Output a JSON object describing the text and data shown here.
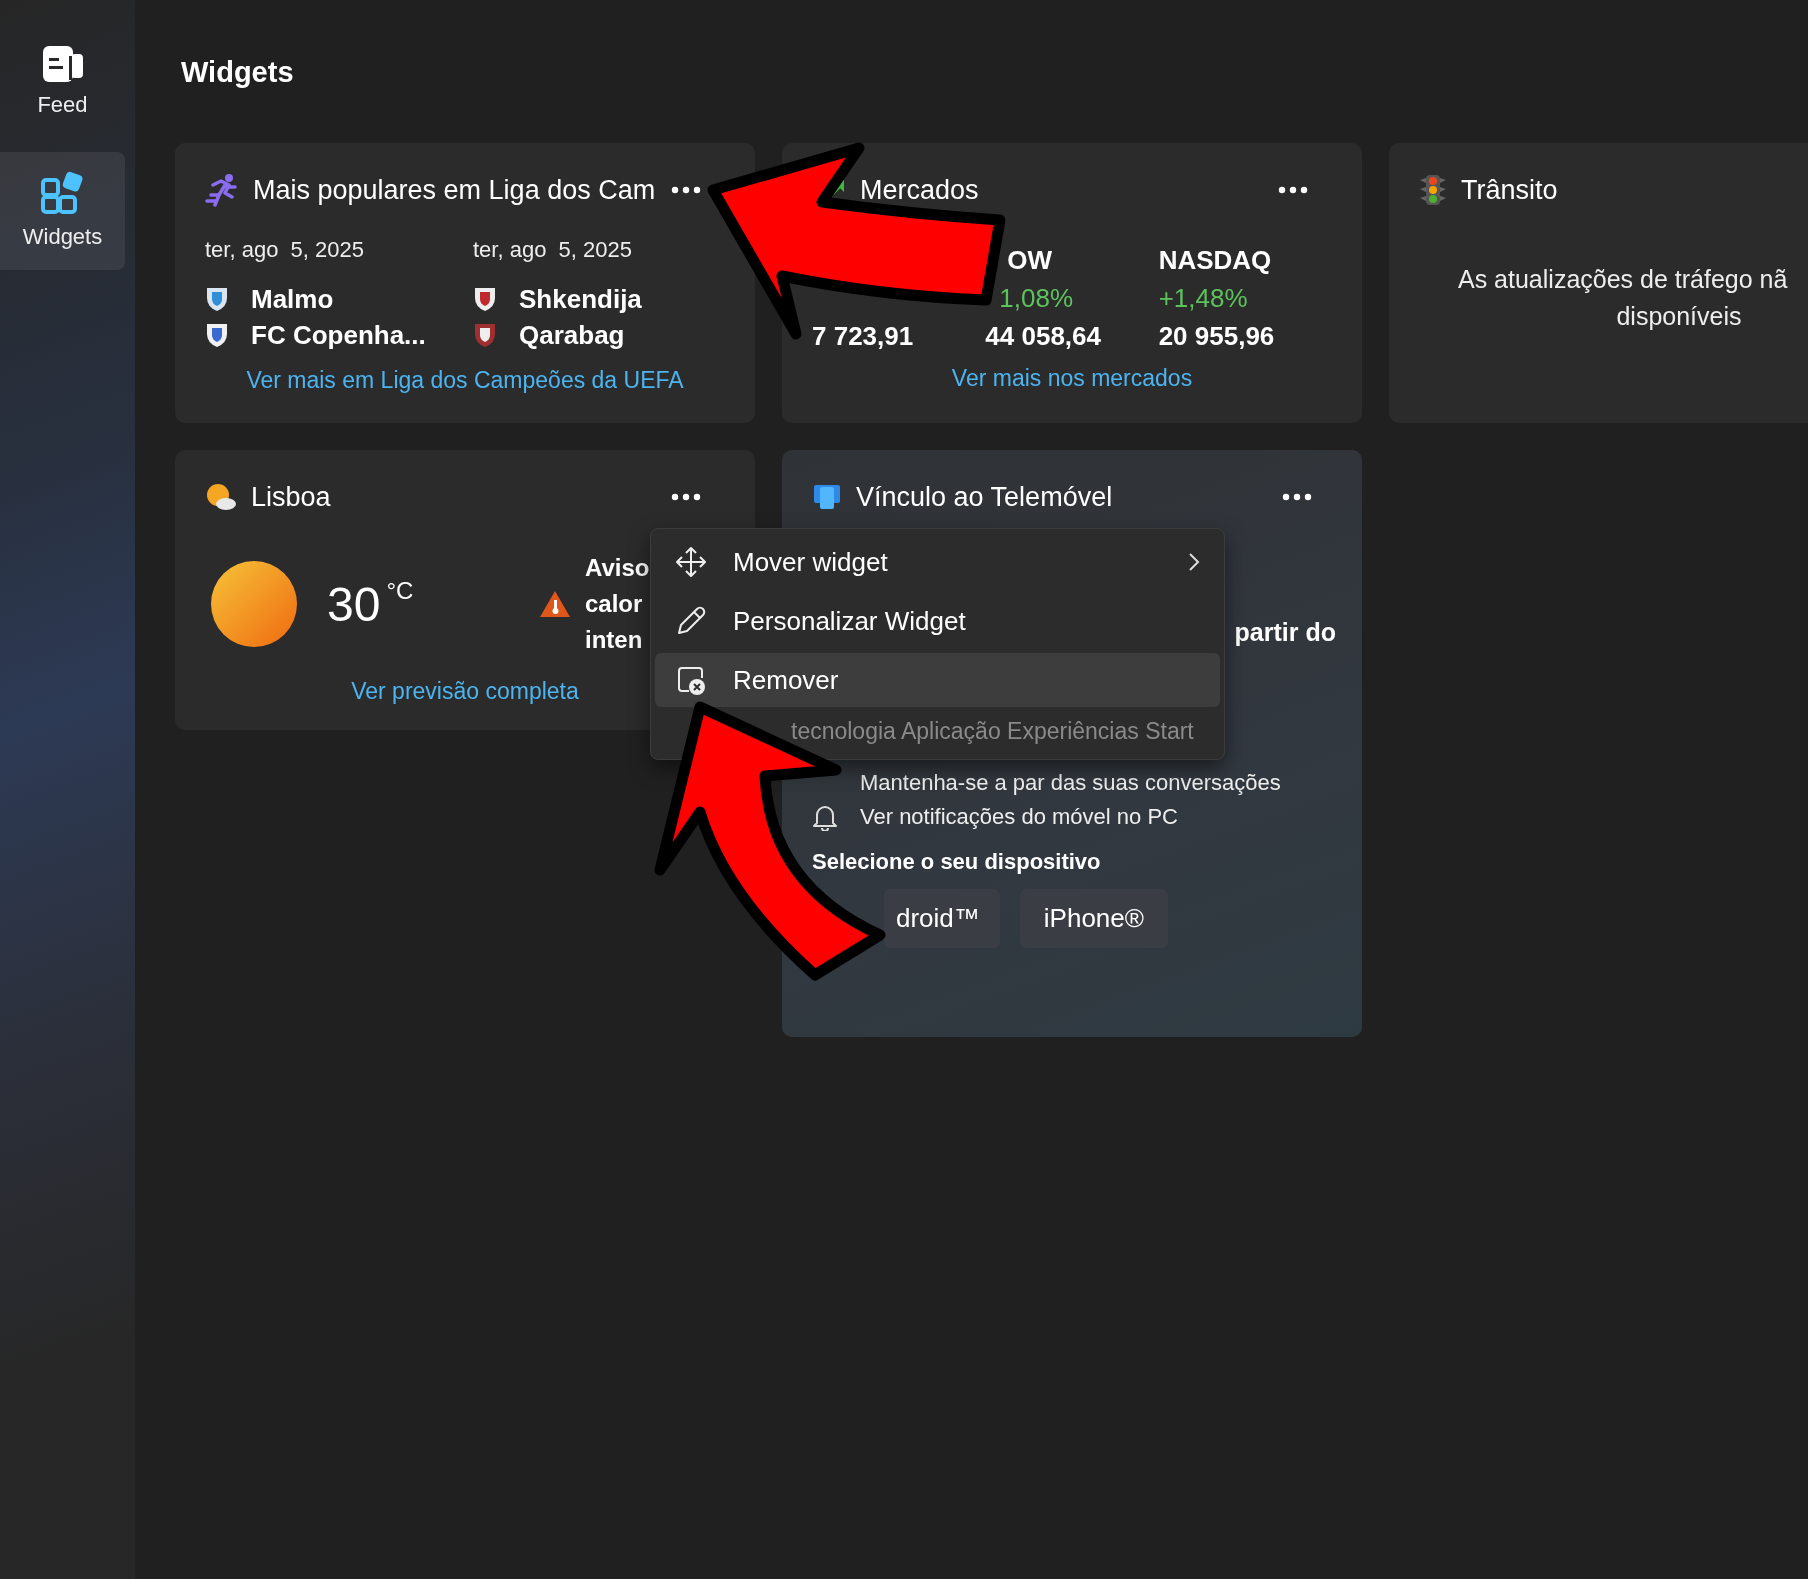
{
  "sidebar": {
    "items": [
      {
        "kind": "feed",
        "label": "Feed",
        "selected": false
      },
      {
        "kind": "widgets",
        "label": "Widgets",
        "selected": true
      }
    ]
  },
  "page_title": "Widgets",
  "widgets": [
    {
      "kind": "sports",
      "title": "Mais populares em Liga dos Cam",
      "menu_button": true,
      "matches": [
        {
          "date": "ter, ago  5, 2025",
          "teams": [
            {
              "name": "Malmo"
            },
            {
              "name": "FC Copenha..."
            }
          ]
        },
        {
          "date": "ter, ago  5, 2025",
          "teams": [
            {
              "name": "Shkendija"
            },
            {
              "name": "Qarabag"
            }
          ]
        }
      ],
      "link": "Ver mais em Liga dos Campeões da UEFA"
    },
    {
      "kind": "markets",
      "title": "Mercados",
      "menu_button": true,
      "indices": [
        {
          "value": "7 723,91"
        },
        {
          "name": "OW",
          "change": "1,08%",
          "value": "44 058,64"
        },
        {
          "name": "NASDAQ",
          "change": "+1,48%",
          "value": "20 955,96"
        }
      ],
      "link": "Ver mais nos mercados"
    },
    {
      "kind": "traffic",
      "title": "Trânsito",
      "menu_button": false,
      "message_lines": [
        "As atualizações de tráfego nã",
        "disponíveis"
      ]
    },
    {
      "kind": "weather",
      "title": "Lisboa",
      "menu_button": true,
      "temperature": "30",
      "unit": "°C",
      "alert": "Aviso calor inten",
      "link": "Ver previsão completa"
    },
    {
      "kind": "phone",
      "title": "Vínculo ao Telemóvel",
      "menu_button": true,
      "intro": "partir do",
      "features": [
        {
          "kind": "conversations",
          "text": "Mantenha-se a par das suas conversações"
        },
        {
          "kind": "notifications",
          "text": "Ver notificações do móvel no PC"
        }
      ],
      "select_label": "Selecione o seu dispositivo",
      "devices": [
        {
          "label": "droid™"
        },
        {
          "label": "iPhone®"
        }
      ]
    }
  ],
  "context_menu": {
    "items": [
      {
        "label": "Mover widget",
        "submenu": true,
        "selected": false
      },
      {
        "label": "Personalizar Widget",
        "submenu": false,
        "selected": false
      },
      {
        "label": "Remover",
        "submenu": false,
        "selected": true
      }
    ],
    "footer": "tecnologia Aplicação Experiências Start"
  },
  "annotations": [
    {
      "kind": "arrow"
    },
    {
      "kind": "arrow"
    }
  ]
}
